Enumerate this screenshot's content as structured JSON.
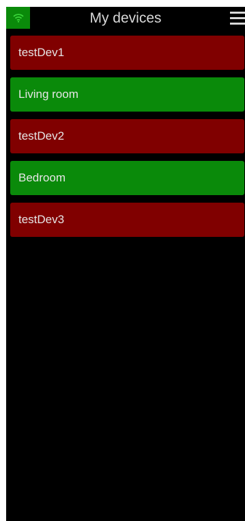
{
  "header": {
    "title": "My devices",
    "wifi_icon": "wifi-icon",
    "menu_icon": "hamburger-menu-icon",
    "wifi_bg_color": "#0a8a0a"
  },
  "devices": [
    {
      "label": "testDev1",
      "status_color": "#800000"
    },
    {
      "label": "Living room",
      "status_color": "#0a8a0a"
    },
    {
      "label": "testDev2",
      "status_color": "#800000"
    },
    {
      "label": "Bedroom",
      "status_color": "#0a8a0a"
    },
    {
      "label": "testDev3",
      "status_color": "#800000"
    }
  ]
}
